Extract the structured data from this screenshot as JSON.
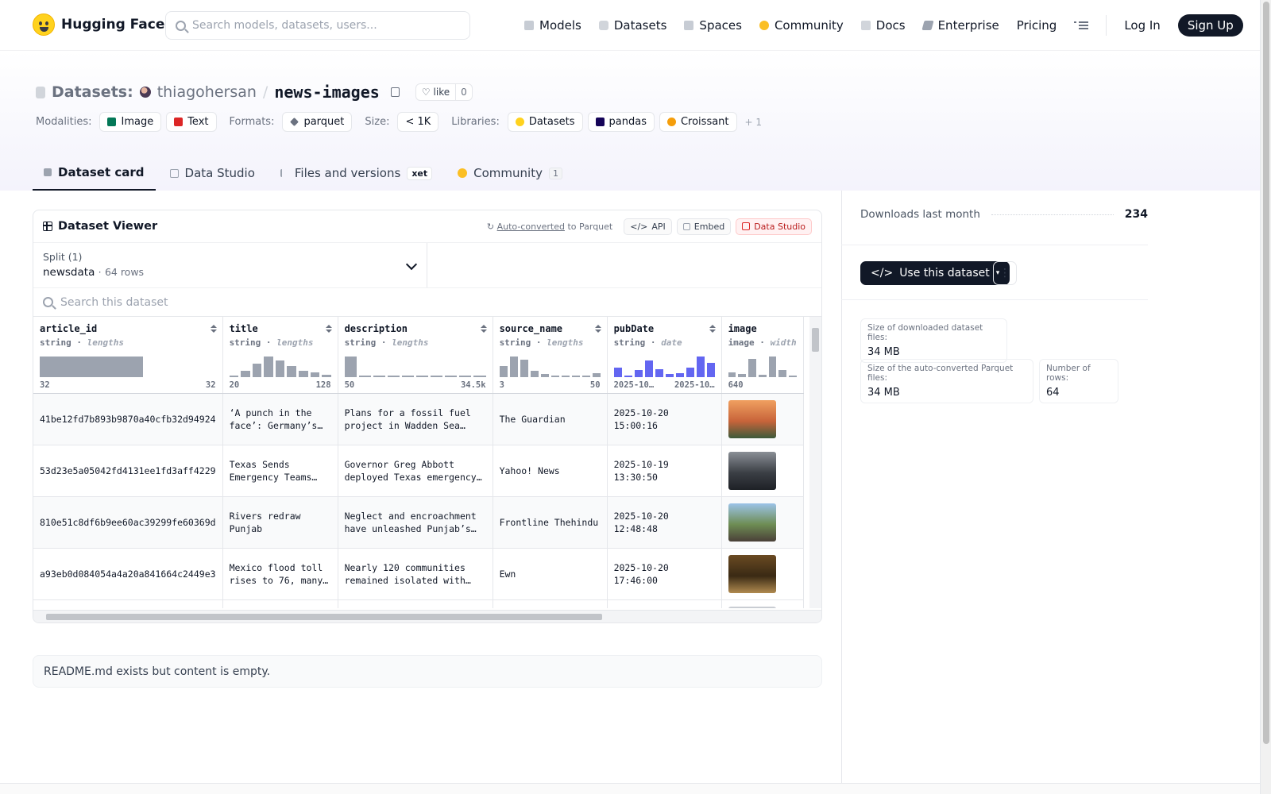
{
  "brand": {
    "name": "Hugging Face"
  },
  "search": {
    "placeholder": "Search models, datasets, users..."
  },
  "nav": {
    "models": "Models",
    "datasets": "Datasets",
    "spaces": "Spaces",
    "community": "Community",
    "docs": "Docs",
    "enterprise": "Enterprise",
    "pricing": "Pricing",
    "login": "Log In",
    "signup": "Sign Up"
  },
  "repo": {
    "section": "Datasets:",
    "owner": "thiagohersan",
    "separator": "/",
    "name": "news-images",
    "like_label": "like",
    "like_count": "0"
  },
  "tags": {
    "modalities_label": "Modalities:",
    "image": "Image",
    "text": "Text",
    "formats_label": "Formats:",
    "parquet": "parquet",
    "size_label": "Size:",
    "size": "< 1K",
    "libraries_label": "Libraries:",
    "datasets": "Datasets",
    "pandas": "pandas",
    "croissant": "Croissant",
    "more": "+ 1"
  },
  "tabs": {
    "card": "Dataset card",
    "studio": "Data Studio",
    "files": "Files and versions",
    "xet": "xet",
    "community": "Community",
    "community_count": "1"
  },
  "viewer": {
    "title": "Dataset Viewer",
    "auto_converted": "Auto-converted",
    "to_parquet": "to Parquet",
    "api": "API",
    "embed": "Embed",
    "data_studio": "Data Studio",
    "split_label": "Split (1)",
    "split_name": "newsdata",
    "split_dot": "·",
    "split_rows": "64 rows",
    "search_placeholder": "Search this dataset",
    "columns": [
      {
        "name": "article_id",
        "type": "string",
        "stat": "lengths",
        "min": "32",
        "max": "32"
      },
      {
        "name": "title",
        "type": "string",
        "stat": "lengths",
        "min": "20",
        "max": "128"
      },
      {
        "name": "description",
        "type": "string",
        "stat": "lengths",
        "min": "50",
        "max": "34.5k"
      },
      {
        "name": "source_name",
        "type": "string",
        "stat": "lengths",
        "min": "3",
        "max": "50"
      },
      {
        "name": "pubDate",
        "type": "string",
        "stat": "date",
        "min": "2025-10…",
        "max": "2025-10…"
      },
      {
        "name": "image",
        "type": "image",
        "stat": "width",
        "min": "640",
        "max": ""
      }
    ],
    "histograms": {
      "article_id": [
        1
      ],
      "title": [
        0.08,
        0.3,
        0.65,
        1,
        0.8,
        0.55,
        0.3,
        0.22,
        0.1
      ],
      "description": [
        1,
        0.06,
        0,
        0,
        0,
        0,
        0,
        0,
        0,
        0
      ],
      "source_name": [
        0.55,
        1,
        0.85,
        0.3,
        0.15,
        0,
        0,
        0,
        0,
        0.18
      ],
      "pubDate": [
        0.45,
        0.08,
        0.35,
        0.8,
        0.4,
        0.15,
        0.2,
        0.45,
        1,
        0.7
      ],
      "image": [
        0.25,
        0.15,
        0.9,
        0.1,
        1,
        0.35,
        0.08
      ]
    },
    "rows": [
      {
        "article_id": "41be12fd7b893b9870a40cfb32d94924",
        "title": "‘A punch in the face’: Germany’s decision…",
        "description": "Plans for a fossil fuel project in Wadden Sea…",
        "source_name": "The Guardian",
        "pubDate": "2025-10-20 15:00:16",
        "image_colors": [
          "#f0a060",
          "#c8643a",
          "#3c5a3a"
        ]
      },
      {
        "article_id": "53d23e5a05042fd4131ee1fd3aff4229",
        "title": "Texas Sends Emergency Teams To…",
        "description": "Governor Greg Abbott deployed Texas emergency…",
        "source_name": "Yahoo! News",
        "pubDate": "2025-10-19 13:30:50",
        "image_colors": [
          "#8a8f96",
          "#3b3f45",
          "#1e2126"
        ]
      },
      {
        "article_id": "810e51c8df6b9ee60ac39299fe60369d",
        "title": "Rivers redraw Punjab",
        "description": "Neglect and encroachment have unleashed Punjab’s…",
        "source_name": "Frontline Thehindu",
        "pubDate": "2025-10-20 12:48:48",
        "image_colors": [
          "#9cc3e8",
          "#6e8d54",
          "#4a4038"
        ]
      },
      {
        "article_id": "a93eb0d084054a4a20a841664c2449e3",
        "title": "Mexico flood toll rises to 76, many…",
        "description": "Nearly 120 communities remained isolated with…",
        "source_name": "Ewn",
        "pubDate": "2025-10-20 17:46:00",
        "image_colors": [
          "#6a4a22",
          "#3a2a14",
          "#b08a50"
        ]
      }
    ]
  },
  "readme": {
    "text": "README.md exists but content is empty."
  },
  "sidebar": {
    "downloads_label": "Downloads last month",
    "downloads": "234",
    "use_button": "Use this dataset",
    "size_downloaded_label": "Size of downloaded dataset files:",
    "size_downloaded": "34 MB",
    "size_parquet_label": "Size of the auto-converted Parquet files:",
    "size_parquet": "34 MB",
    "rows_label": "Number of rows:",
    "rows": "64"
  },
  "colors": {
    "accent_dark": "#111827",
    "hist_gray": "#9ca3af",
    "hist_blue": "#6366f1",
    "studio_red": "#b91c1c",
    "brand_yellow": "#ffd21e"
  }
}
